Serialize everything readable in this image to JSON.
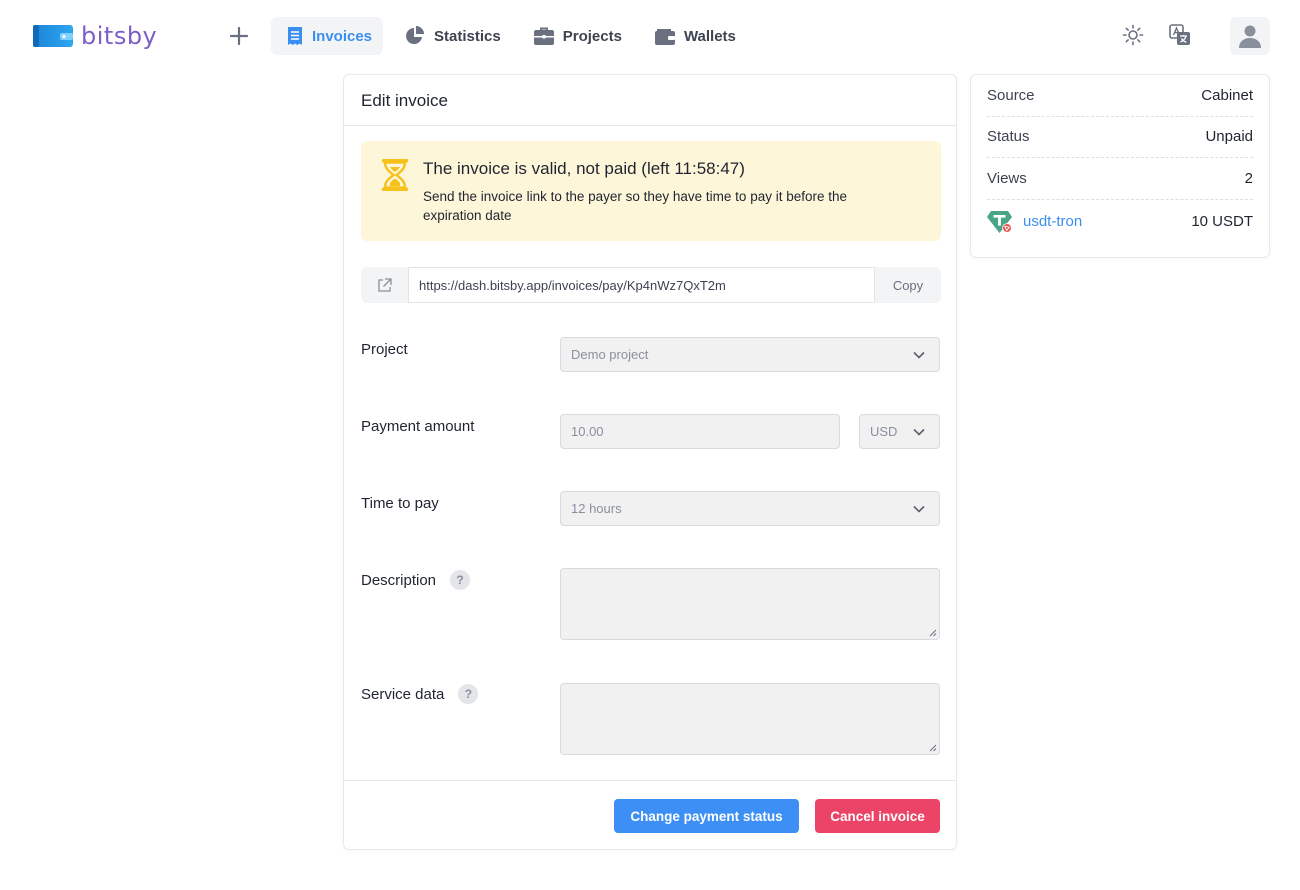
{
  "brand": {
    "name": "bitsby"
  },
  "nav": {
    "items": [
      {
        "label": "Invoices",
        "active": true
      },
      {
        "label": "Statistics",
        "active": false
      },
      {
        "label": "Projects",
        "active": false
      },
      {
        "label": "Wallets",
        "active": false
      }
    ]
  },
  "invoice": {
    "title": "Edit invoice",
    "alert": {
      "title": "The invoice is valid, not paid (left 11:58:47)",
      "text": "Send the invoice link to the payer so they have time to pay it before the expiration date"
    },
    "link": {
      "url": "https://dash.bitsby.app/invoices/pay/Kp4nWz7QxT2m",
      "copy_label": "Copy"
    },
    "fields": {
      "project_label": "Project",
      "project_value": "Demo project",
      "amount_label": "Payment amount",
      "amount_value": "10.00",
      "currency_value": "USD",
      "time_label": "Time to pay",
      "time_value": "12 hours",
      "description_label": "Description",
      "service_label": "Service data",
      "help_glyph": "?"
    },
    "actions": {
      "change_status": "Change payment status",
      "cancel": "Cancel invoice"
    }
  },
  "details": {
    "rows": [
      {
        "label": "Source",
        "value": "Cabinet"
      },
      {
        "label": "Status",
        "value": "Unpaid"
      },
      {
        "label": "Views",
        "value": "2"
      }
    ],
    "coin": {
      "name": "usdt-tron",
      "amount": "10 USDT"
    }
  },
  "colors": {
    "accent": "#3b8ff0",
    "primary_button": "#3d8ff5",
    "danger_button": "#eb4466",
    "alert_bg": "#fef6d9",
    "hourglass": "#f5c11a",
    "tether": "#4aa587",
    "tron": "#e8534f"
  }
}
